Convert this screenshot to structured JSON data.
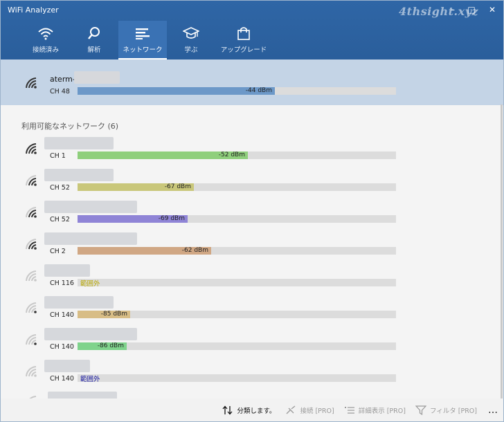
{
  "window": {
    "title": "WiFi Analyzer",
    "watermark": "4thsight.xyz"
  },
  "tabs": [
    {
      "label": "接続済み",
      "icon": "wifi-icon"
    },
    {
      "label": "解析",
      "icon": "magnifier-icon"
    },
    {
      "label": "ネットワーク",
      "icon": "list-icon",
      "active": true
    },
    {
      "label": "学ぶ",
      "icon": "graduation-cap-icon"
    },
    {
      "label": "アップグレード",
      "icon": "shopping-bag-icon"
    }
  ],
  "connected": {
    "ssid": "aterm-",
    "channel": "CH 48",
    "signal": "-44 dBm",
    "level": 0.62,
    "color": "#6c98c8"
  },
  "available": {
    "title": "利用可能なネットワーク (6)",
    "networks": [
      {
        "channel": "CH 1",
        "signal": "-52 dBm",
        "level": 0.535,
        "color": "#8fcf7c",
        "strength": 4
      },
      {
        "channel": "CH 52",
        "signal": "-67 dBm",
        "level": 0.365,
        "color": "#c9c77a",
        "strength": 3
      },
      {
        "channel": "CH 52",
        "signal": "-69 dBm",
        "level": 0.345,
        "color": "#8f84d6",
        "strength": 3
      },
      {
        "channel": "CH 2",
        "signal": "-62 dBm",
        "level": 0.42,
        "color": "#d0a784",
        "strength": 3
      },
      {
        "channel": "CH 116",
        "signal": "範囲外",
        "level": 0,
        "color": "#c9c77a",
        "strength": 0,
        "outOfRange": true,
        "labelColor": "#b8a800"
      },
      {
        "channel": "CH 140",
        "signal": "-85 dBm",
        "level": 0.165,
        "color": "#d8bd86",
        "strength": 1
      },
      {
        "channel": "CH 140",
        "signal": "-86 dBm",
        "level": 0.155,
        "color": "#7fd38c",
        "strength": 1
      },
      {
        "channel": "CH 140",
        "signal": "範囲外",
        "level": 0,
        "color": "#8f84d6",
        "strength": 0,
        "outOfRange": true,
        "labelColor": "#1a1aa0"
      }
    ]
  },
  "footer": {
    "sort": "分類します。",
    "connect": "接続 [PRO]",
    "details": "詳細表示 [PRO]",
    "filter": "フィルタ [PRO]",
    "more": "…"
  }
}
